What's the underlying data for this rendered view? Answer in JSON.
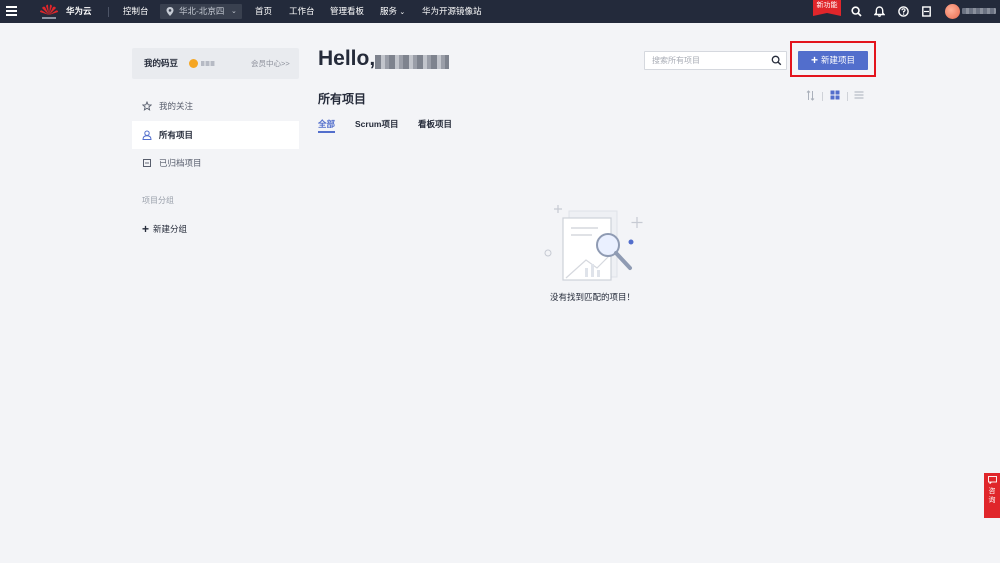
{
  "topbar": {
    "brand": "华为云",
    "console": "控制台",
    "region": "华北-北京四",
    "nav": [
      "首页",
      "工作台",
      "管理看板",
      "服务",
      "华为开源镜像站"
    ],
    "new_feature_badge": "新功能",
    "icons": [
      "search-icon",
      "bell-icon",
      "help-icon",
      "calendar-icon"
    ]
  },
  "sidebar": {
    "bean_title": "我的码豆",
    "member_center": "会员中心>>",
    "items": [
      {
        "label": "我的关注",
        "icon": "star-icon"
      },
      {
        "label": "所有项目",
        "icon": "user-icon",
        "active": true
      },
      {
        "label": "已归档项目",
        "icon": "archive-icon"
      }
    ],
    "group_title": "项目分组",
    "new_group": "新建分组"
  },
  "main": {
    "greeting": "Hello,",
    "search_placeholder": "搜索所有项目",
    "new_project": "新建项目",
    "section_title": "所有项目",
    "tabs": [
      "全部",
      "Scrum项目",
      "看板项目"
    ],
    "active_tab": "全部",
    "empty_text": "没有找到匹配的项目！"
  },
  "float_button": "咨\n询",
  "colors": {
    "topbar": "#232a3b",
    "accent": "#526ecc",
    "highlight": "#e3141d",
    "badge": "#e0262b"
  }
}
